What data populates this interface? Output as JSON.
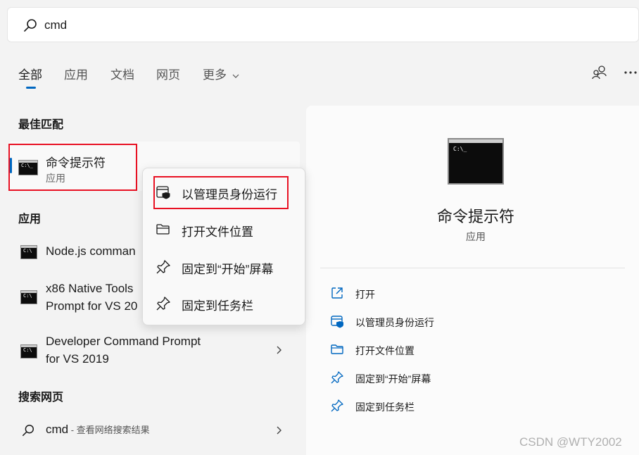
{
  "search": {
    "query": "cmd"
  },
  "tabs": [
    {
      "label": "全部",
      "active": true
    },
    {
      "label": "应用"
    },
    {
      "label": "文档"
    },
    {
      "label": "网页"
    },
    {
      "label": "更多"
    }
  ],
  "sections": {
    "best_match": "最佳匹配",
    "apps": "应用",
    "web": "搜索网页"
  },
  "best_match": {
    "title": "命令提示符",
    "subtitle": "应用"
  },
  "apps": [
    {
      "line1": "Node.js comman",
      "line2": ""
    },
    {
      "line1": "x86 Native Tools",
      "line2": "Prompt for VS 20"
    },
    {
      "line1": "Developer Command Prompt",
      "line2": "for VS 2019"
    }
  ],
  "web_result": {
    "query": "cmd",
    "suffix": " - 查看网络搜索结果"
  },
  "context_menu": [
    {
      "label": "以管理员身份运行",
      "icon": "admin-shield-icon"
    },
    {
      "label": "打开文件位置",
      "icon": "folder-icon"
    },
    {
      "label": "固定到“开始”屏幕",
      "icon": "pin-icon"
    },
    {
      "label": "固定到任务栏",
      "icon": "pin-icon"
    }
  ],
  "detail": {
    "title": "命令提示符",
    "subtitle": "应用",
    "actions": [
      {
        "label": "打开",
        "icon": "open-external-icon"
      },
      {
        "label": "以管理员身份运行",
        "icon": "admin-shield-icon"
      },
      {
        "label": "打开文件位置",
        "icon": "folder-icon"
      },
      {
        "label": "固定到“开始”屏幕",
        "icon": "pin-icon"
      },
      {
        "label": "固定到任务栏",
        "icon": "pin-icon"
      }
    ]
  },
  "watermark": "CSDN @WTY2002",
  "colors": {
    "accent": "#0067c0",
    "highlight": "#e81123"
  }
}
